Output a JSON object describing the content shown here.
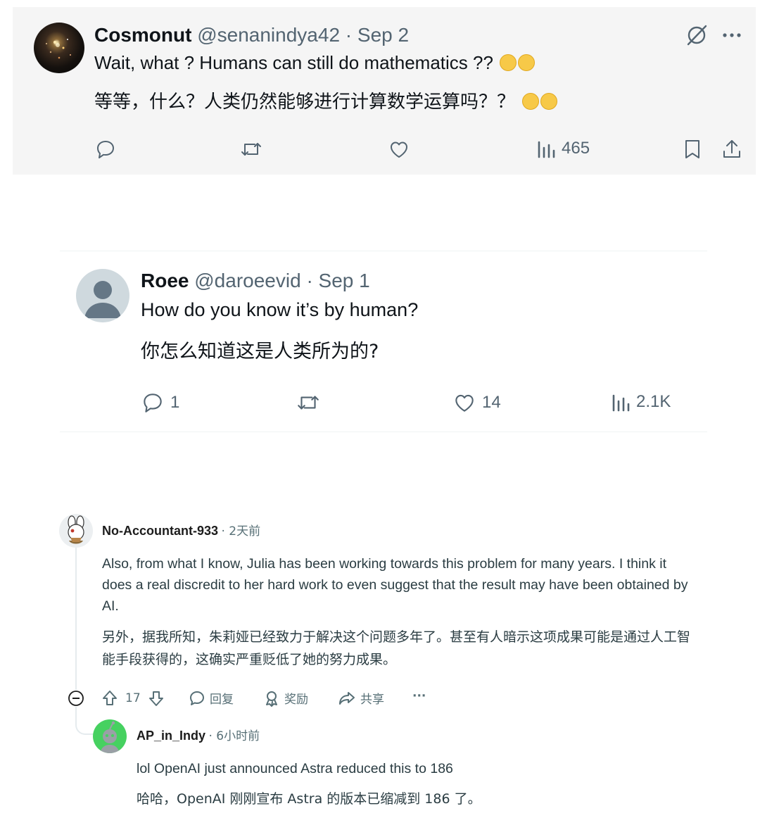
{
  "tweet1": {
    "author_name": "Cosmonut",
    "author_handle": "@senanindya42",
    "date": "· Sep 2",
    "text_en": "Wait, what ? Humans can still do mathematics ??",
    "text_zh": "等等，什么？人类仍然能够进行计算数学运算吗？？",
    "views": "465",
    "icons": [
      "reply-icon",
      "retweet-icon",
      "like-icon",
      "views-icon",
      "bookmark-icon",
      "share-icon",
      "grok-icon",
      "more-icon"
    ]
  },
  "tweet2": {
    "author_name": "Roee",
    "author_handle": "@daroeevid",
    "date": "· Sep 1",
    "text_en": "How do you know it’s by human?",
    "text_zh": "你怎么知道这是人类所为的?",
    "replies": "1",
    "likes": "14",
    "views": "2.1K"
  },
  "reddit_comment": {
    "username": "No-Accountant-933",
    "time": "· 2天前",
    "text_en": "Also, from what I know, Julia has been working towards this problem for many years. I think it does a real discredit to her hard work to even suggest that the result may have been obtained by AI.",
    "text_zh": "另外，据我所知，朱莉娅已经致力于解决这个问题多年了。甚至有人暗示这项成果可能是通过人工智能手段获得的，这确实严重贬低了她的努力成果。",
    "votes": "17",
    "reply_label": "回复",
    "award_label": "奖励",
    "share_label": "共享",
    "more_label": "···"
  },
  "reddit_reply": {
    "username": "AP_in_Indy",
    "time": "· 6小时前",
    "text_en": "lol OpenAI just announced Astra reduced this to 186",
    "text_zh": "哈哈，OpenAI 刚刚宣布 Astra 的版本已缩减到 186 了。"
  },
  "colors": {
    "tweet_bg": "#f5f5f5",
    "muted": "#536471",
    "reddit_muted": "#576f76",
    "reddit_avatar_green": "#46d160"
  }
}
